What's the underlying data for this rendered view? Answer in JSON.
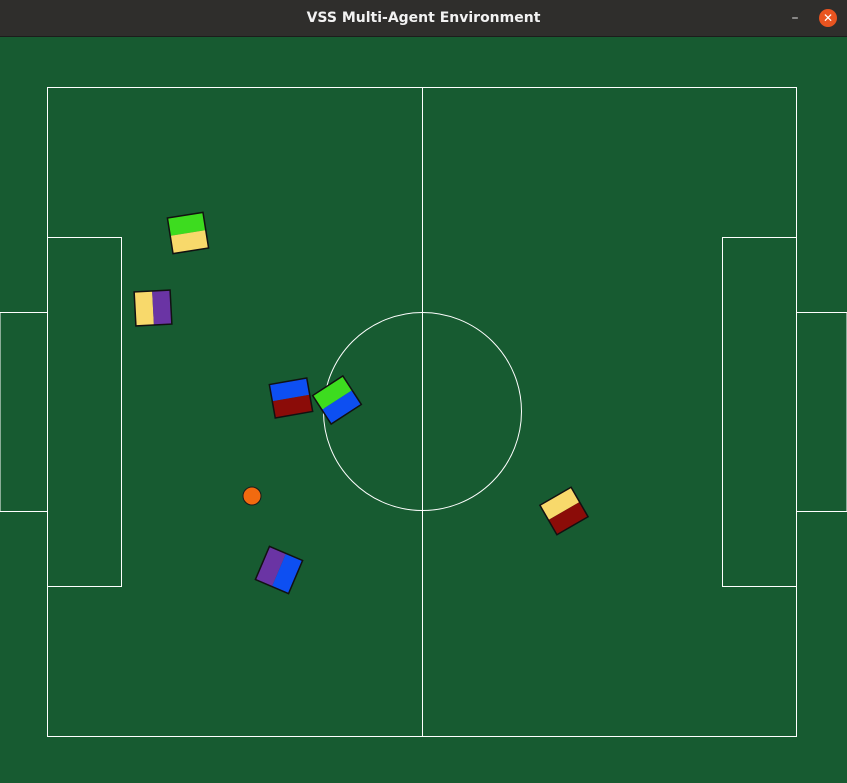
{
  "window": {
    "title": "VSS Multi-Agent Environment",
    "minimize_icon": "minimize-icon",
    "close_icon": "close-icon"
  },
  "colors": {
    "field": "#175b31",
    "lines": "#ffffff",
    "ball": "#f26a0f",
    "green": "#3ddc1f",
    "yellow": "#f8d96b",
    "purple": "#6a34a4",
    "blue": "#0d4ff2",
    "red": "#8b0c08"
  },
  "robots": [
    {
      "name": "robot-green-yellow",
      "top_color": "green",
      "bottom_color": "yellow"
    },
    {
      "name": "robot-yellow-purple",
      "top_color": "yellow",
      "bottom_color": "purple"
    },
    {
      "name": "robot-blue-red",
      "top_color": "blue",
      "bottom_color": "red"
    },
    {
      "name": "robot-green-blue",
      "top_color": "green",
      "bottom_color": "blue"
    },
    {
      "name": "robot-yellow-red",
      "top_color": "yellow",
      "bottom_color": "red"
    },
    {
      "name": "robot-purple-blue",
      "top_color": "purple",
      "bottom_color": "blue"
    }
  ]
}
